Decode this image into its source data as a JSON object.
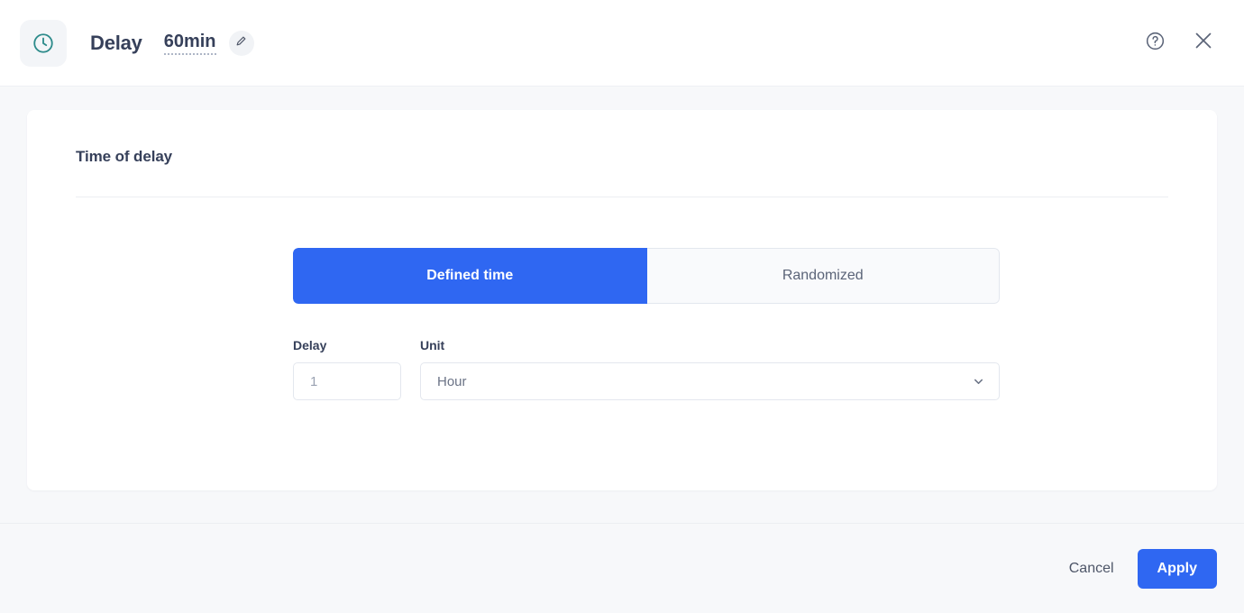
{
  "header": {
    "node_icon": "clock-icon",
    "title": "Delay",
    "value": "60min",
    "edit_icon": "pencil-icon",
    "help_icon": "help-circle-icon",
    "close_icon": "close-icon",
    "accent_icon_color": "#2d8b8b"
  },
  "content": {
    "section_title": "Time of delay",
    "tabs": [
      {
        "label": "Defined time",
        "active": true
      },
      {
        "label": "Randomized",
        "active": false
      }
    ],
    "fields": {
      "delay": {
        "label": "Delay",
        "value": "",
        "placeholder": "1"
      },
      "unit": {
        "label": "Unit",
        "value": "Hour",
        "chevron_icon": "chevron-down-icon",
        "options": [
          "Hour"
        ]
      }
    }
  },
  "footer": {
    "cancel_label": "Cancel",
    "apply_label": "Apply"
  },
  "colors": {
    "primary": "#2f67f2",
    "page_bg": "#f7f8fa",
    "card_bg": "#ffffff",
    "text": "#36405a",
    "muted_text": "#6b7386",
    "border": "#e3e7ee"
  }
}
